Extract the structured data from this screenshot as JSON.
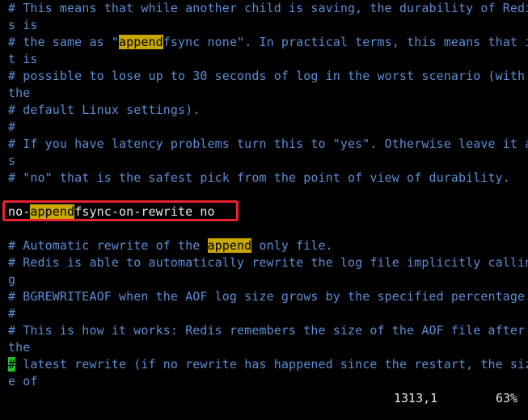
{
  "editor": {
    "lines": [
      {
        "segments": [
          "# This means that while another child is saving, the durability of Redi"
        ]
      },
      {
        "segments": [
          "s is"
        ]
      },
      {
        "segments": [
          "# the same as \"",
          "append",
          "fsync none\". In practical terms, this means that i"
        ]
      },
      {
        "segments": [
          "t is"
        ]
      },
      {
        "segments": [
          "# possible to lose up to 30 seconds of log in the worst scenario (with"
        ]
      },
      {
        "segments": [
          "the"
        ]
      },
      {
        "segments": [
          "# default Linux settings)."
        ]
      },
      {
        "segments": [
          "#"
        ]
      },
      {
        "segments": [
          "# If you have latency problems turn this to \"yes\". Otherwise leave it a"
        ]
      },
      {
        "segments": [
          "s"
        ]
      },
      {
        "segments": [
          "# \"no\" that is the safest pick from the point of view of durability."
        ]
      },
      {
        "segments": [
          ""
        ]
      },
      {
        "segments": [
          "no-",
          "append",
          "fsync-on-rewrite no"
        ]
      },
      {
        "segments": [
          ""
        ]
      },
      {
        "segments": [
          "# Automatic rewrite of the ",
          "append",
          " only file."
        ]
      },
      {
        "segments": [
          "# Redis is able to automatically rewrite the log file implicitly callin"
        ]
      },
      {
        "segments": [
          "g"
        ]
      },
      {
        "segments": [
          "# BGREWRITEAOF when the AOF log size grows by the specified percentage."
        ]
      },
      {
        "segments": [
          "#"
        ]
      },
      {
        "segments": [
          "# This is how it works: Redis remembers the size of the AOF file after"
        ]
      },
      {
        "segments": [
          "the"
        ]
      },
      {
        "segments": [
          "#",
          " latest rewrite (if no rewrite has happened since the restart, the siz"
        ]
      },
      {
        "segments": [
          "e of"
        ]
      }
    ]
  },
  "statusbar": {
    "position": "1313,1",
    "percent": "63%"
  },
  "colors": {
    "background": "#000000",
    "comment": "#5b8ed6",
    "code": "#e8e8e8",
    "search_highlight": "#c8a800",
    "cursor": "#22c22a",
    "annotation_box": "#e8232d"
  }
}
